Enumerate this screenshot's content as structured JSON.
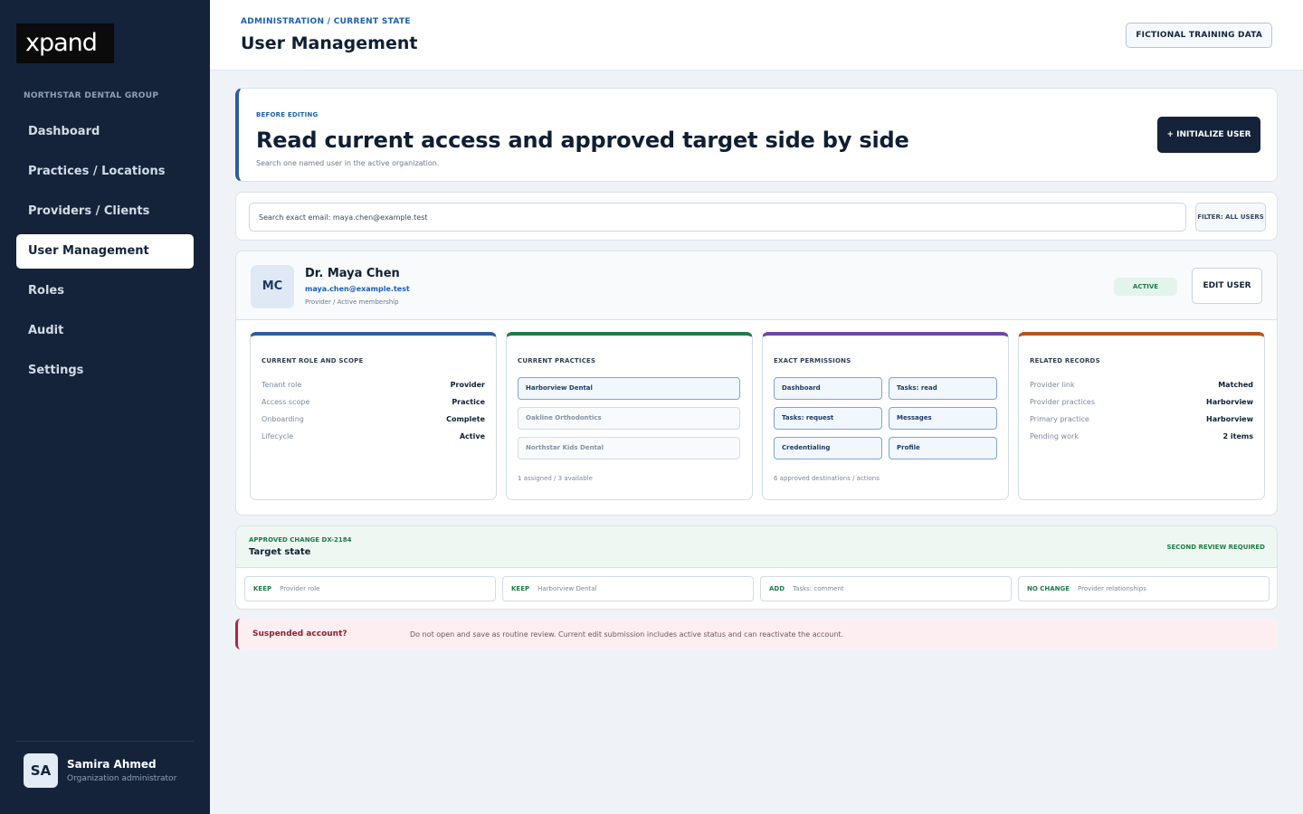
{
  "sidebar": {
    "logo": "xpand",
    "org": "NORTHSTAR DENTAL GROUP",
    "items": [
      {
        "label": "Dashboard"
      },
      {
        "label": "Practices / Locations"
      },
      {
        "label": "Providers / Clients"
      },
      {
        "label": "User Management"
      },
      {
        "label": "Roles"
      },
      {
        "label": "Audit"
      },
      {
        "label": "Settings"
      }
    ],
    "active_index": 3,
    "current_user": {
      "initials": "SA",
      "name": "Samira Ahmed",
      "role": "Organization administrator"
    }
  },
  "header": {
    "breadcrumb": "ADMINISTRATION / CURRENT STATE",
    "title": "User Management",
    "badge": "FICTIONAL TRAINING DATA"
  },
  "hero": {
    "eyebrow": "BEFORE EDITING",
    "title": "Read current access and approved target side by side",
    "subtitle": "Search one named user in the active organization.",
    "button": "+ INITIALIZE USER"
  },
  "search": {
    "value": "Search exact email: maya.chen@example.test",
    "filter": "FILTER: ALL USERS"
  },
  "user": {
    "initials": "MC",
    "name": "Dr. Maya Chen",
    "email": "maya.chen@example.test",
    "meta": "Provider / Active membership",
    "status": "ACTIVE",
    "edit_button": "EDIT USER"
  },
  "panels": {
    "role": {
      "title": "CURRENT ROLE AND SCOPE",
      "accent": "#2d5e9e",
      "rows": [
        {
          "k": "Tenant role",
          "v": "Provider"
        },
        {
          "k": "Access scope",
          "v": "Practice"
        },
        {
          "k": "Onboarding",
          "v": "Complete"
        },
        {
          "k": "Lifecycle",
          "v": "Active"
        }
      ]
    },
    "practices": {
      "title": "CURRENT PRACTICES",
      "accent": "#1f7a49",
      "items": [
        {
          "label": "Harborview Dental",
          "selected": true
        },
        {
          "label": "Oakline Orthodontics",
          "selected": false
        },
        {
          "label": "Northstar Kids Dental",
          "selected": false
        }
      ],
      "footer": "1 assigned / 3 available"
    },
    "permissions": {
      "title": "EXACT PERMISSIONS",
      "accent": "#6b47a8",
      "items": [
        {
          "label": "Dashboard"
        },
        {
          "label": "Tasks: read"
        },
        {
          "label": "Tasks: request"
        },
        {
          "label": "Messages"
        },
        {
          "label": "Credentialing"
        },
        {
          "label": "Profile"
        }
      ],
      "footer": "6 approved destinations / actions"
    },
    "records": {
      "title": "RELATED RECORDS",
      "accent": "#b4531c",
      "rows": [
        {
          "k": "Provider link",
          "v": "Matched"
        },
        {
          "k": "Provider practices",
          "v": "Harborview"
        },
        {
          "k": "Primary practice",
          "v": "Harborview"
        },
        {
          "k": "Pending work",
          "v": "2 items"
        }
      ]
    }
  },
  "target": {
    "eyebrow": "APPROVED CHANGE DX-2184",
    "title": "Target state",
    "review": "SECOND REVIEW REQUIRED",
    "items": [
      {
        "tag": "KEEP",
        "desc": "Provider role"
      },
      {
        "tag": "KEEP",
        "desc": "Harborview Dental"
      },
      {
        "tag": "ADD",
        "desc": "Tasks: comment"
      },
      {
        "tag": "NO CHANGE",
        "desc": "Provider relationships"
      }
    ]
  },
  "warning": {
    "title": "Suspended account?",
    "text": "Do not open and save as routine review. Current edit submission includes active status and can reactivate the account."
  }
}
